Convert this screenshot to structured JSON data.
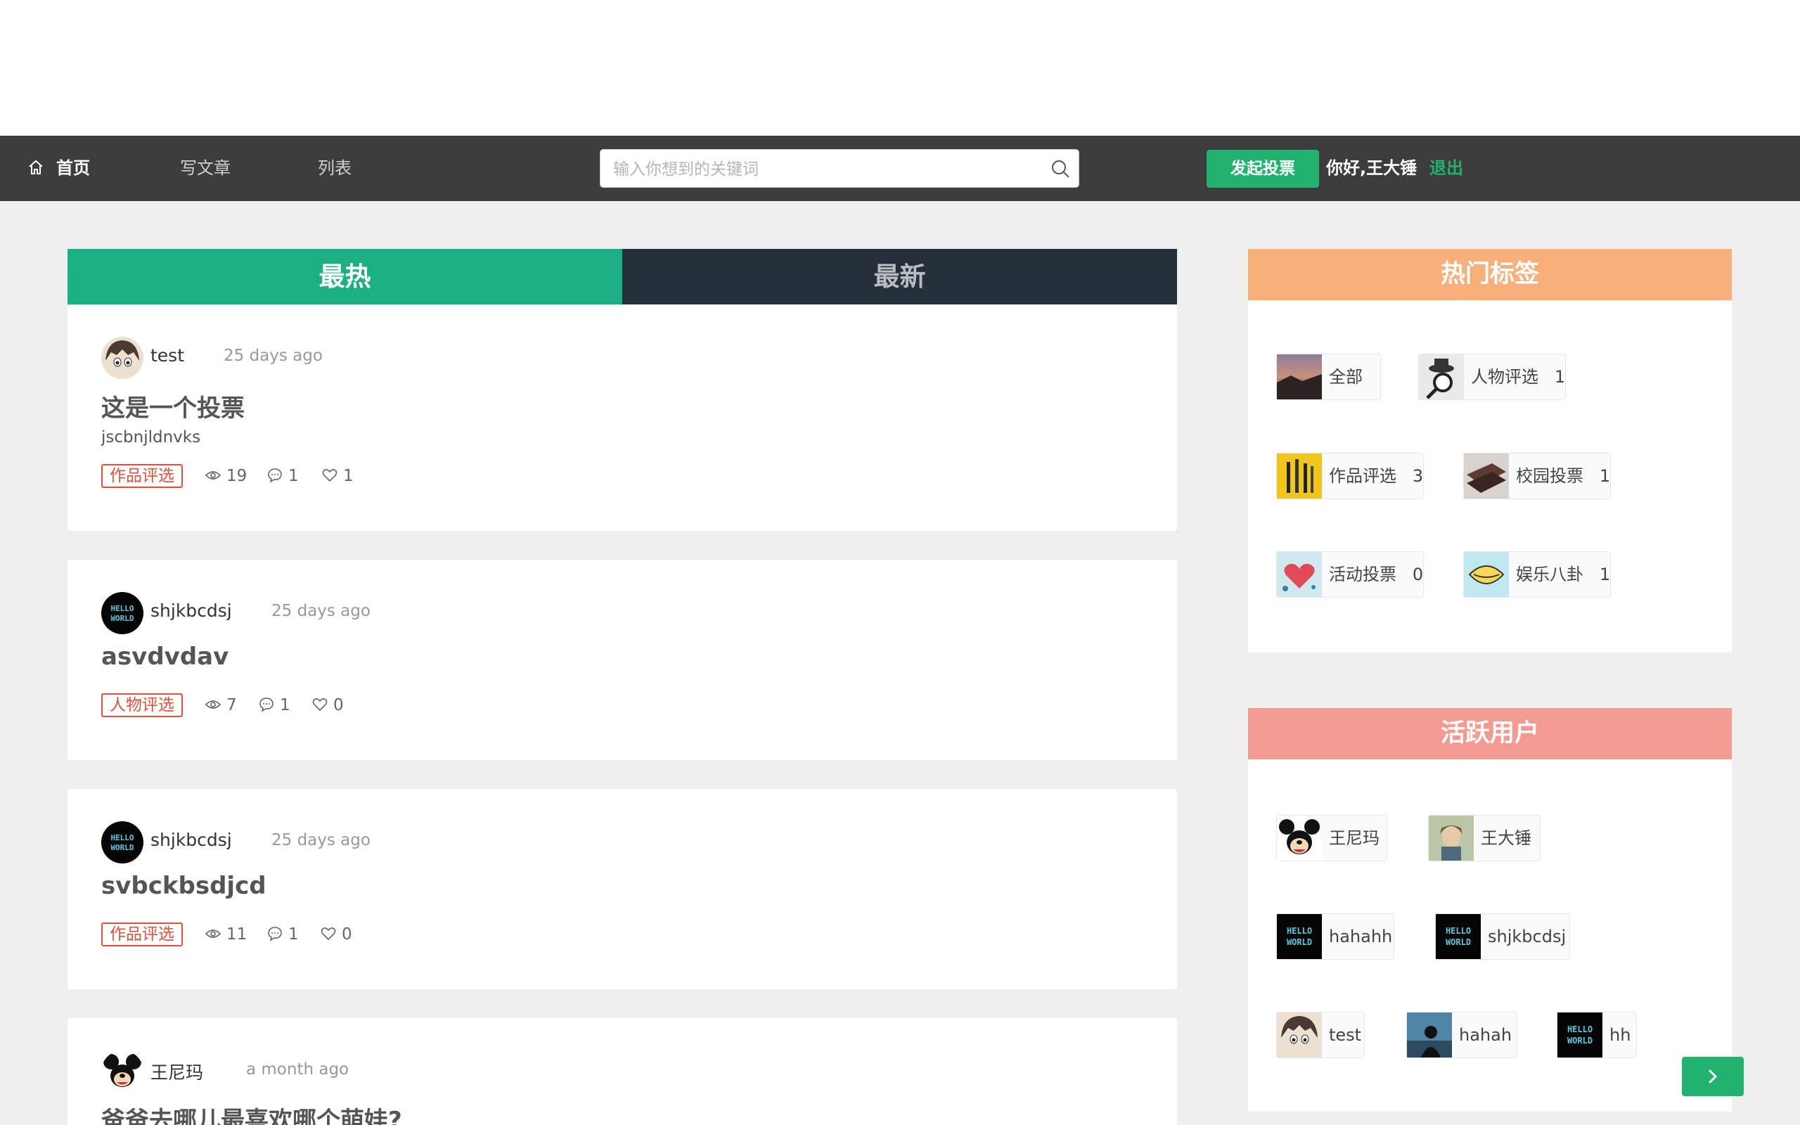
{
  "nav": {
    "home": "首页",
    "write": "写文章",
    "list": "列表",
    "search_placeholder": "输入你想到的关键词",
    "vote_button": "发起投票",
    "greeting": "你好,王大锤",
    "logout": "退出"
  },
  "tabs": {
    "hot": "最热",
    "new": "最新"
  },
  "posts": [
    {
      "author": "test",
      "time": "25 days ago",
      "title": "这是一个投票",
      "desc": "jscbnjldnvks",
      "tag": "作品评选",
      "views": "19",
      "comments": "1",
      "likes": "1"
    },
    {
      "author": "shjkbcdsj",
      "time": "25 days ago",
      "title": "asvdvdav",
      "tag": "人物评选",
      "views": "7",
      "comments": "1",
      "likes": "0"
    },
    {
      "author": "shjkbcdsj",
      "time": "25 days ago",
      "title": "svbckbsdjcd",
      "tag": "作品评选",
      "views": "11",
      "comments": "1",
      "likes": "0"
    },
    {
      "author": "王尼玛",
      "time": "a month ago",
      "title": "爸爸去哪儿最喜欢哪个萌娃?"
    }
  ],
  "hot_tags": {
    "title": "热门标签",
    "items": [
      {
        "label": "全部"
      },
      {
        "label": "人物评选",
        "count": "1"
      },
      {
        "label": "作品评选",
        "count": "3"
      },
      {
        "label": "校园投票",
        "count": "1"
      },
      {
        "label": "活动投票",
        "count": "0"
      },
      {
        "label": "娱乐八卦",
        "count": "1"
      }
    ]
  },
  "active_users": {
    "title": "活跃用户",
    "items": [
      "王尼玛",
      "王大锤",
      "hahahh",
      "shjkbcdsj",
      "test",
      "hahah",
      "hh"
    ]
  },
  "colors": {
    "nav_bg": "#3d3d3d",
    "accent_green": "#21b26f",
    "tab_hot": "#1ab084",
    "tab_new": "#252f3a",
    "tag_red": "#e2503c",
    "panel_tags": "#f8b07a",
    "panel_users": "#f49b91"
  },
  "icons": [
    "home-icon",
    "search-icon",
    "eye-icon",
    "comment-icon",
    "heart-icon",
    "chevron-right-icon"
  ]
}
